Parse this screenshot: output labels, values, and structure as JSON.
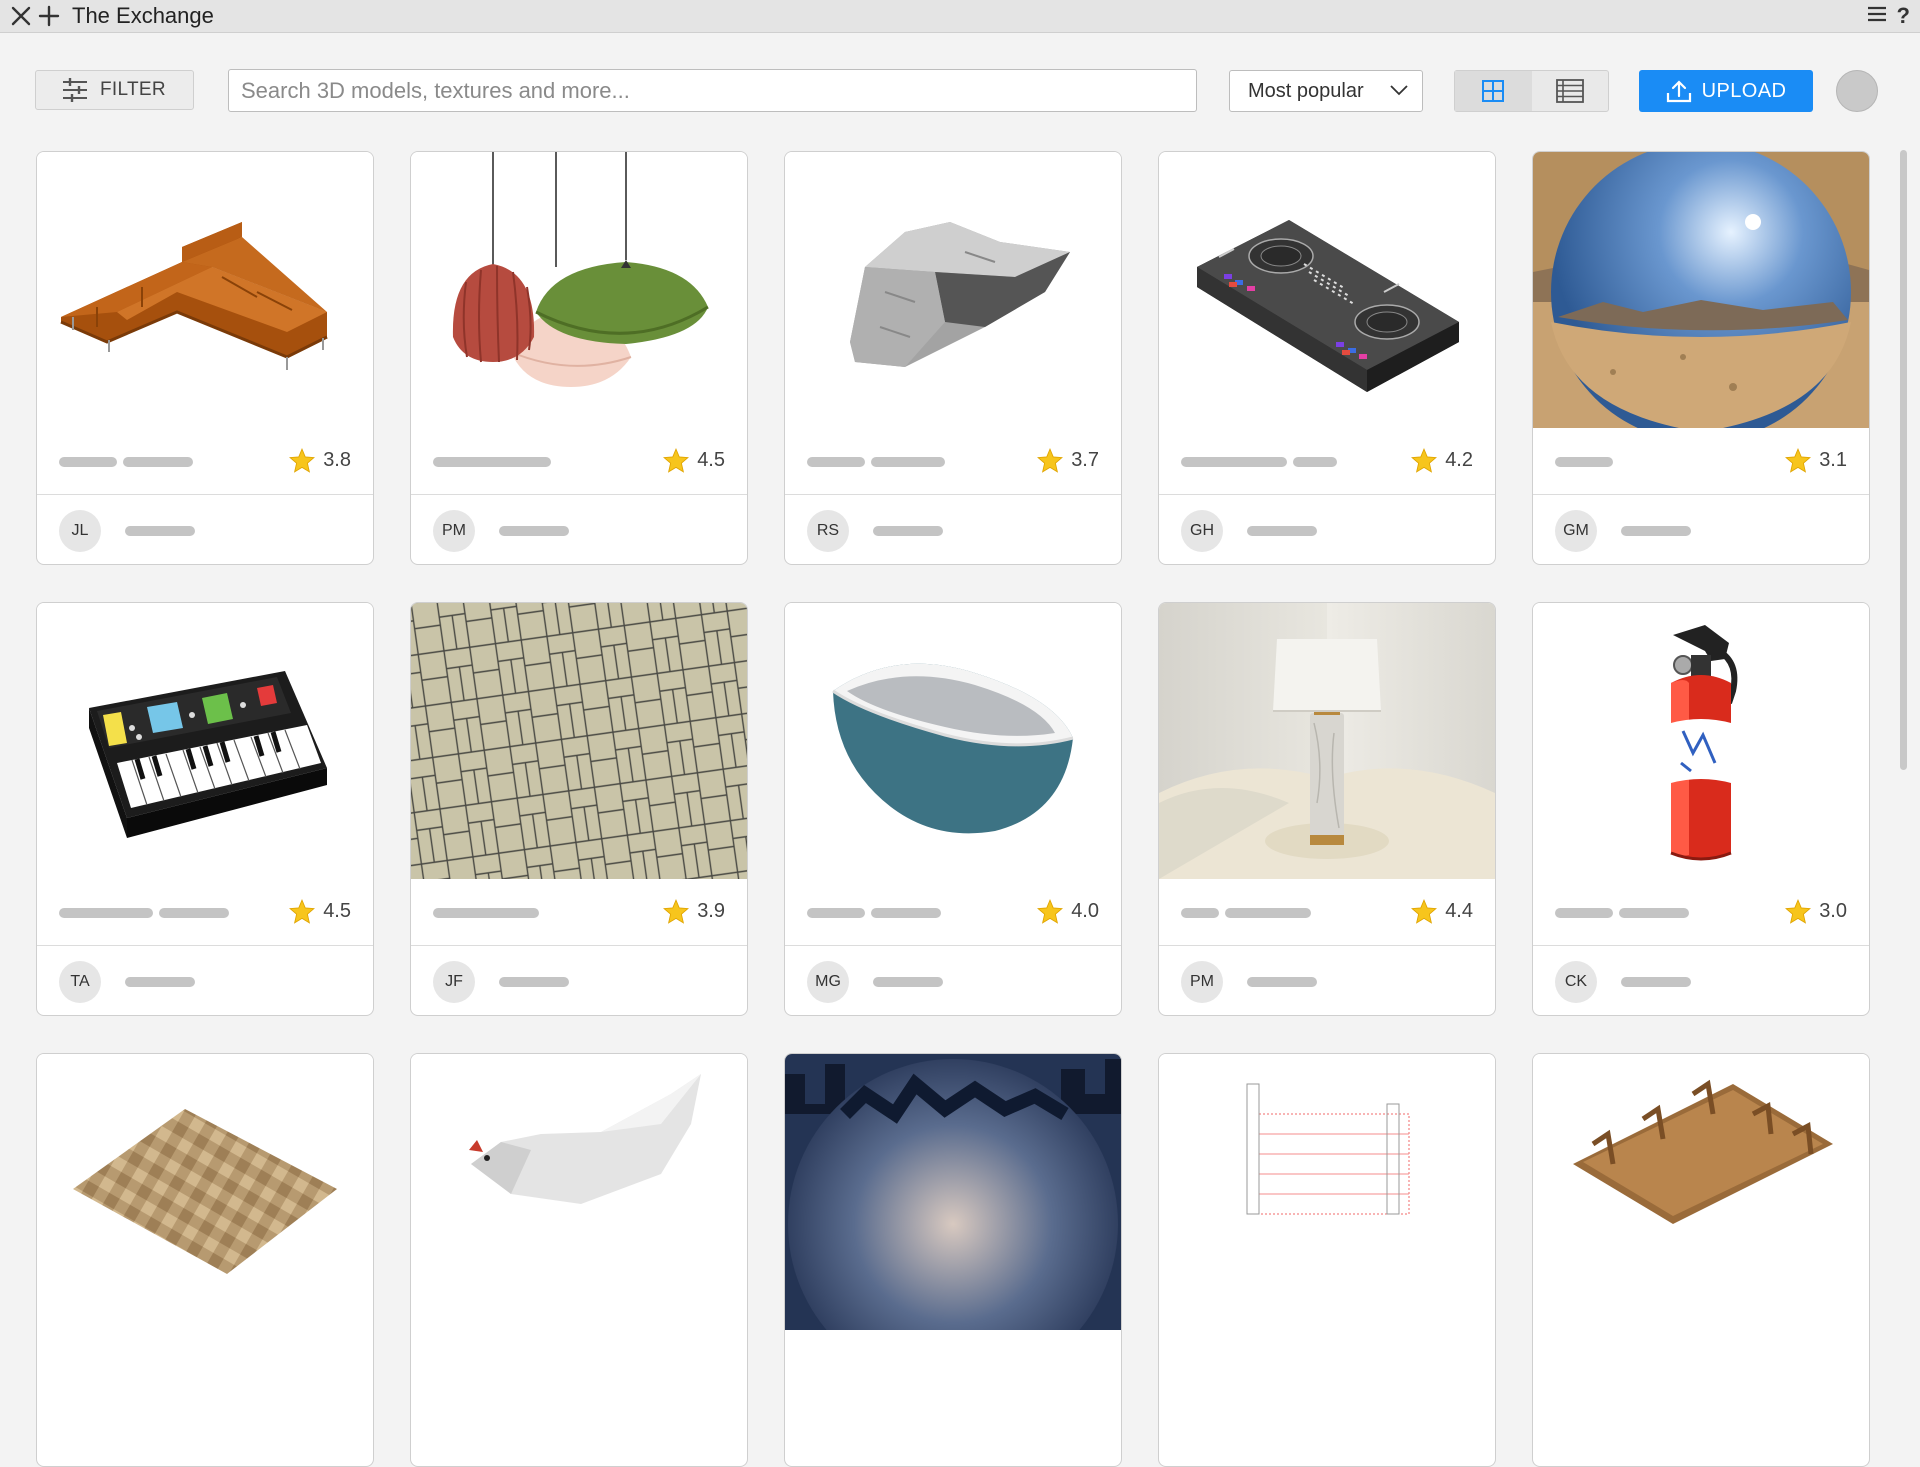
{
  "window": {
    "title": "The Exchange"
  },
  "toolbar": {
    "filter_label": "FILTER",
    "search_placeholder": "Search 3D models, textures and more...",
    "sort_value": "Most popular",
    "upload_label": "UPLOAD"
  },
  "colors": {
    "accent": "#1a8cf5",
    "star": "#f7c51c",
    "card_border": "#cfcfcf"
  },
  "cards": [
    {
      "subject": "sectional-sofa",
      "rating": "3.8",
      "author": "JL"
    },
    {
      "subject": "pendant-lamps",
      "rating": "4.5",
      "author": "PM"
    },
    {
      "subject": "rock",
      "rating": "3.7",
      "author": "RS"
    },
    {
      "subject": "dj-controller",
      "rating": "4.2",
      "author": "GH"
    },
    {
      "subject": "hdri-desert",
      "rating": "3.1",
      "author": "GM"
    },
    {
      "subject": "synthesizer",
      "rating": "4.5",
      "author": "TA"
    },
    {
      "subject": "paving-texture",
      "rating": "3.9",
      "author": "JF"
    },
    {
      "subject": "bathtub",
      "rating": "4.0",
      "author": "MG"
    },
    {
      "subject": "table-lamp",
      "rating": "4.4",
      "author": "PM"
    },
    {
      "subject": "fire-extinguisher",
      "rating": "3.0",
      "author": "CK"
    },
    {
      "subject": "parquet-floor",
      "rating": "",
      "author": ""
    },
    {
      "subject": "low-poly-chicken",
      "rating": "",
      "author": ""
    },
    {
      "subject": "hdri-city",
      "rating": "",
      "author": ""
    },
    {
      "subject": "building-drawing",
      "rating": "",
      "author": ""
    },
    {
      "subject": "dining-table",
      "rating": "",
      "author": ""
    }
  ]
}
